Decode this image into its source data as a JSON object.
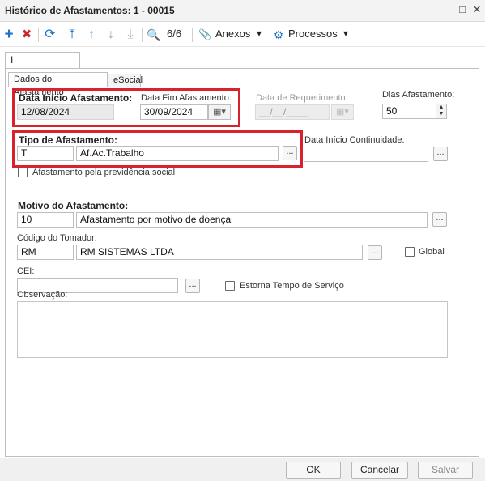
{
  "window": {
    "title": "Histórico de Afastamentos: 1 - 00015",
    "restore_glyph": "□",
    "close_glyph": "✕"
  },
  "toolbar": {
    "add_glyph": "+",
    "delete_glyph": "✖",
    "refresh_glyph": "⟳",
    "first_glyph": "⤒",
    "prev_glyph": "↑",
    "next_glyph": "↓",
    "last_glyph": "⤓",
    "search_glyph": "🔍",
    "record_count": "6/6",
    "attachments_glyph": "📎",
    "attachments_label": "Anexos",
    "processes_glyph": "⚙",
    "processes_label": "Processos",
    "dropdown_glyph": "▾"
  },
  "tabs": {
    "top": "Identificação",
    "sub": [
      "Dados do Afastamento",
      "eSocial"
    ]
  },
  "form": {
    "data_inicio_label": "Data Início Afastamento:",
    "data_inicio_value": "12/08/2024",
    "data_fim_label": "Data Fim Afastamento:",
    "data_fim_value": "30/09/2024",
    "calendar_glyph": "▦▾",
    "data_requerimento_label": "Data de Requerimento:",
    "data_requerimento_value": "__/__/____",
    "dias_label": "Dias Afastamento:",
    "dias_value": "50",
    "spin_up": "▲",
    "spin_down": "▼",
    "tipo_label": "Tipo de Afastamento:",
    "tipo_code": "T",
    "tipo_desc": "Af.Ac.Trabalho",
    "lookup_glyph": "...",
    "data_continuidade_label": "Data Início Continuidade:",
    "data_continuidade_value": "",
    "previdencia_label": "Afastamento pela previdência social",
    "motivo_label": "Motivo do Afastamento:",
    "motivo_code": "10",
    "motivo_desc": "Afastamento por motivo de doença",
    "tomador_label": "Código do Tomador:",
    "tomador_code": "RM",
    "tomador_desc": "RM SISTEMAS LTDA",
    "global_label": "Global",
    "cei_label": "CEI:",
    "cei_value": "",
    "estorna_label": "Estorna Tempo de Serviço",
    "observacao_label": "Observação:",
    "observacao_value": ""
  },
  "buttons": {
    "ok": "OK",
    "cancel": "Cancelar",
    "save": "Salvar"
  },
  "colors": {
    "highlight": "#d9222c",
    "add_icon": "#1a73c9",
    "delete_icon": "#c8282e",
    "nav_icon": "#1a73c9"
  }
}
